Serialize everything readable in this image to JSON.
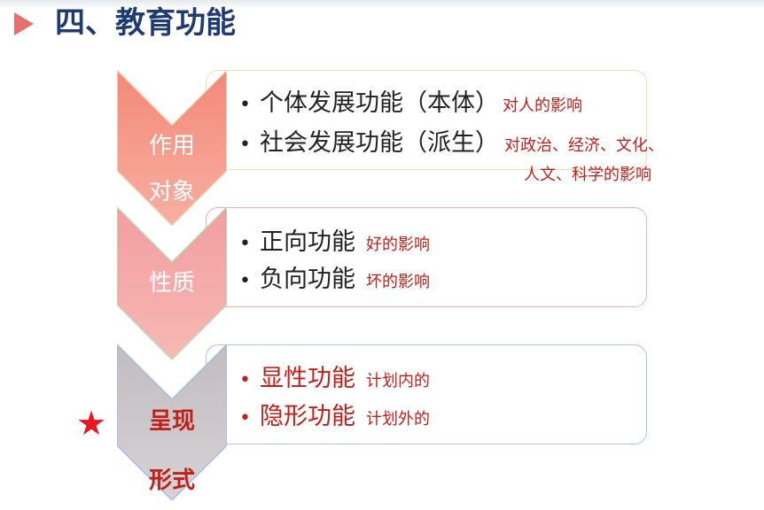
{
  "title": {
    "text": "四、教育功能",
    "arrow_icon": "triangle-right-icon",
    "arrow_color": "#e4726a",
    "color": "#1f3b73"
  },
  "sections": [
    {
      "label_lines": [
        "作用",
        "对象"
      ],
      "chevron_color": "#f29384",
      "bullets": [
        {
          "text": "个体发展功能（本体）",
          "note": "对人的影响",
          "note_cont": ""
        },
        {
          "text": "社会发展功能（派生）",
          "note": "对政治、经济、文化、",
          "note_cont": "人文、科学的影响"
        }
      ]
    },
    {
      "label_lines": [
        "性质"
      ],
      "chevron_color": "#f2a7a7",
      "bullets": [
        {
          "text": "正向功能",
          "note": "好的影响"
        },
        {
          "text": "负向功能",
          "note": "坏的影响"
        }
      ]
    },
    {
      "label_lines": [
        "呈现",
        "形式"
      ],
      "chevron_color": "#c8c4c8",
      "bullets": [
        {
          "text": "显性功能",
          "note": "计划内的"
        },
        {
          "text": "隐形功能",
          "note": "计划外的"
        }
      ]
    }
  ],
  "marker": {
    "symbol": "★",
    "icon": "star-icon",
    "color": "#e8161e"
  },
  "bullet_symbol": "•",
  "note_color": "#c0201a"
}
